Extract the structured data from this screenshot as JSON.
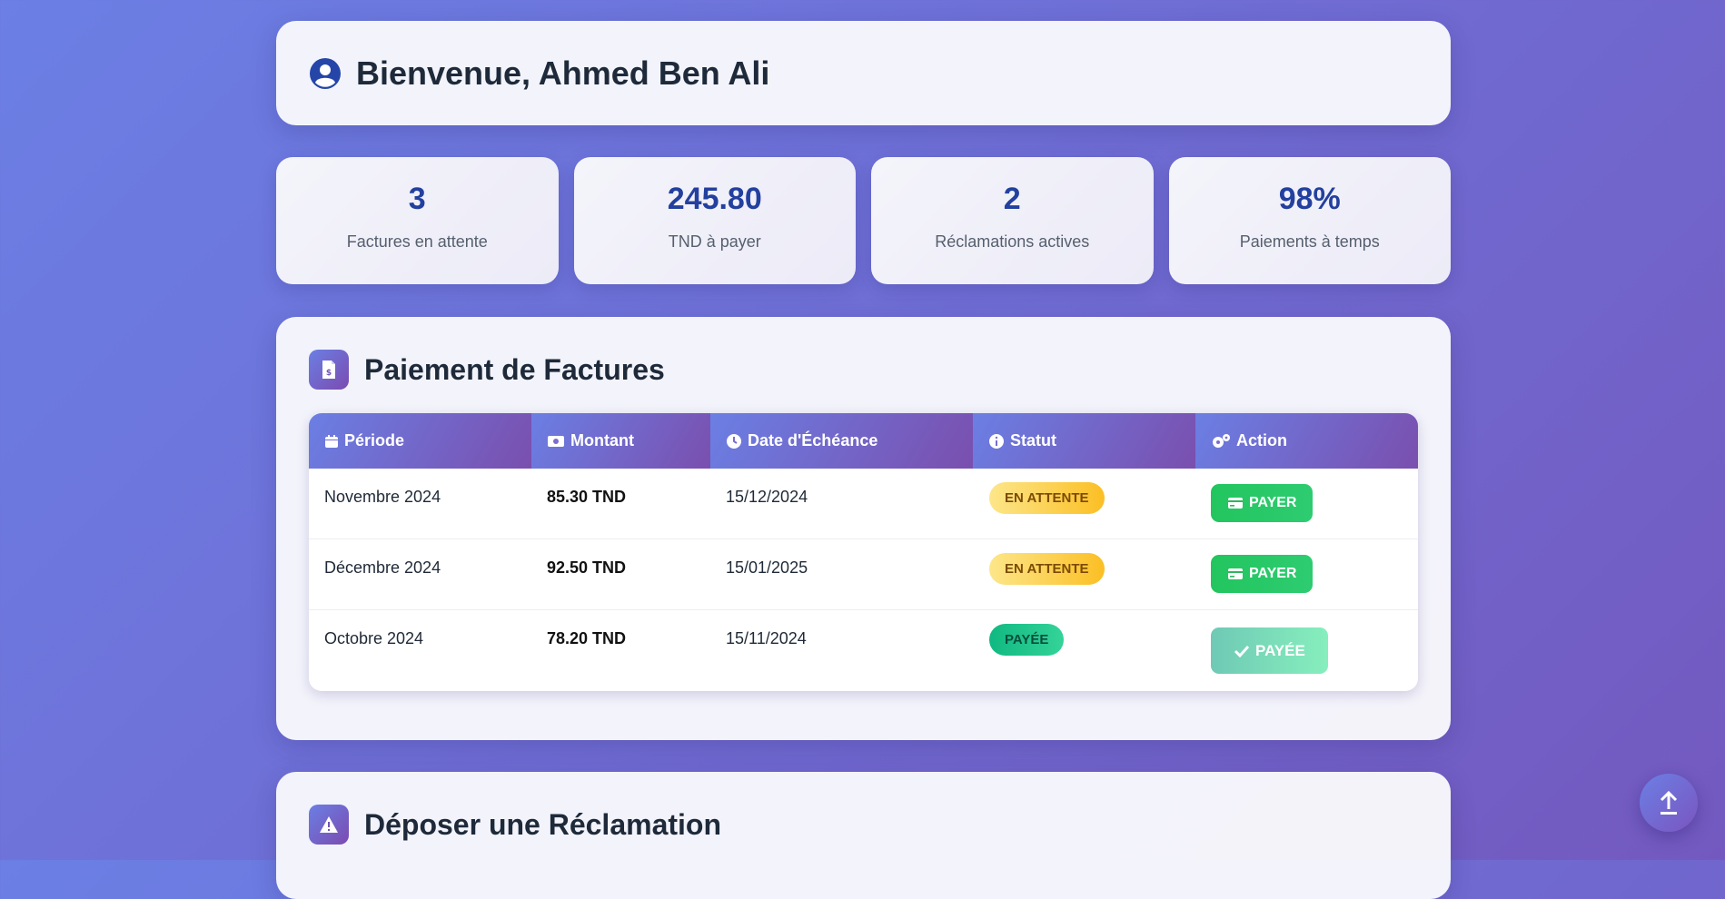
{
  "welcome": {
    "title": "Bienvenue, Ahmed Ben Ali"
  },
  "stats": [
    {
      "value": "3",
      "label": "Factures en attente"
    },
    {
      "value": "245.80",
      "label": "TND à payer"
    },
    {
      "value": "2",
      "label": "Réclamations actives"
    },
    {
      "value": "98%",
      "label": "Paiements à temps"
    }
  ],
  "payments": {
    "title": "Paiement de Factures",
    "columns": [
      "Période",
      "Montant",
      "Date d'Échéance",
      "Statut",
      "Action"
    ],
    "rows": [
      {
        "period": "Novembre 2024",
        "amount": "85.30 TND",
        "due": "15/12/2024",
        "status": "EN ATTENTE",
        "action": "PAYER"
      },
      {
        "period": "Décembre 2024",
        "amount": "92.50 TND",
        "due": "15/01/2025",
        "status": "EN ATTENTE",
        "action": "PAYER"
      },
      {
        "period": "Octobre 2024",
        "amount": "78.20 TND",
        "due": "15/11/2024",
        "status": "PAYÉE",
        "action": "PAYÉE"
      }
    ]
  },
  "complaint": {
    "title": "Déposer une Réclamation"
  },
  "colors": {
    "accent": "#23409e",
    "pending": "#fbbf24",
    "paid": "#10b981",
    "pay_button": "#22c55e"
  },
  "icons": [
    "user-circle-icon",
    "invoice-icon",
    "calendar-icon",
    "money-icon",
    "clock-icon",
    "info-icon",
    "gears-icon",
    "credit-card-icon",
    "check-icon",
    "warning-icon",
    "arrow-up-icon"
  ]
}
